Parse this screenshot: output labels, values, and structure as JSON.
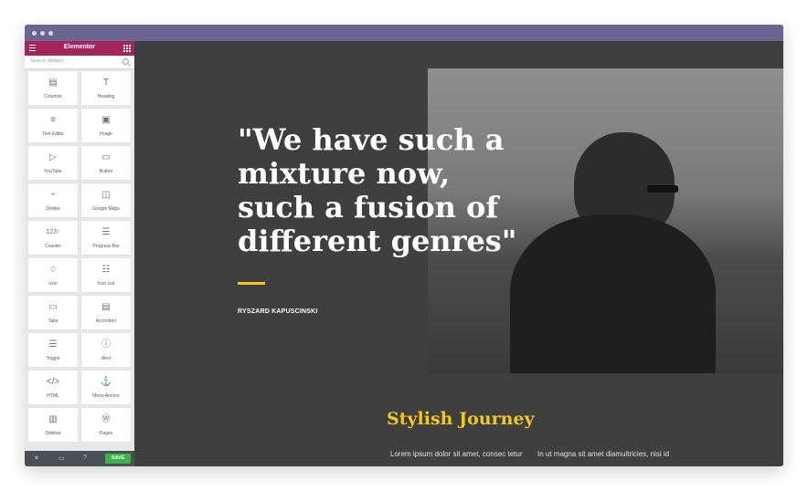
{
  "sidebar": {
    "title": "Elementor",
    "search_placeholder": "Search Widget...",
    "widgets": [
      {
        "label": "Columns",
        "icon": "columns-icon"
      },
      {
        "label": "Heading",
        "icon": "heading-icon"
      },
      {
        "label": "Text Editor",
        "icon": "text-editor-icon"
      },
      {
        "label": "Image",
        "icon": "image-icon"
      },
      {
        "label": "YouTube",
        "icon": "youtube-icon"
      },
      {
        "label": "Button",
        "icon": "button-icon"
      },
      {
        "label": "Divider",
        "icon": "divider-icon"
      },
      {
        "label": "Google Maps",
        "icon": "google-maps-icon"
      },
      {
        "label": "Counter",
        "icon": "counter-icon"
      },
      {
        "label": "Progress Bar",
        "icon": "progress-bar-icon"
      },
      {
        "label": "Icon",
        "icon": "star-icon"
      },
      {
        "label": "Icon List",
        "icon": "icon-list-icon"
      },
      {
        "label": "Tabs",
        "icon": "tabs-icon"
      },
      {
        "label": "Accordion",
        "icon": "accordion-icon"
      },
      {
        "label": "Toggle",
        "icon": "toggle-icon"
      },
      {
        "label": "Alert",
        "icon": "alert-icon"
      },
      {
        "label": "HTML",
        "icon": "code-icon"
      },
      {
        "label": "Menu Anchor",
        "icon": "anchor-icon"
      },
      {
        "label": "Sidebar",
        "icon": "sidebar-icon"
      },
      {
        "label": "Pages",
        "icon": "wordpress-icon"
      }
    ],
    "footer": {
      "save_label": "SAVE"
    }
  },
  "content": {
    "quote_lines": [
      "\"We have such a",
      "mixture now,",
      "such a fusion of",
      "different genres\""
    ],
    "author": "RYSZARD KAPUSCINSKI",
    "section_title": "Stylish Journey",
    "para_left": "Lorem ipsum dolor sit amet, consec tetur",
    "para_right": "In ut magna sit amet diamultricies, nisi id"
  },
  "colors": {
    "titlebar": "#6c6591",
    "elementor_header": "#a4255c",
    "canvas": "#3f3f3f",
    "accent": "#f2c81d",
    "save": "#39b54a"
  }
}
